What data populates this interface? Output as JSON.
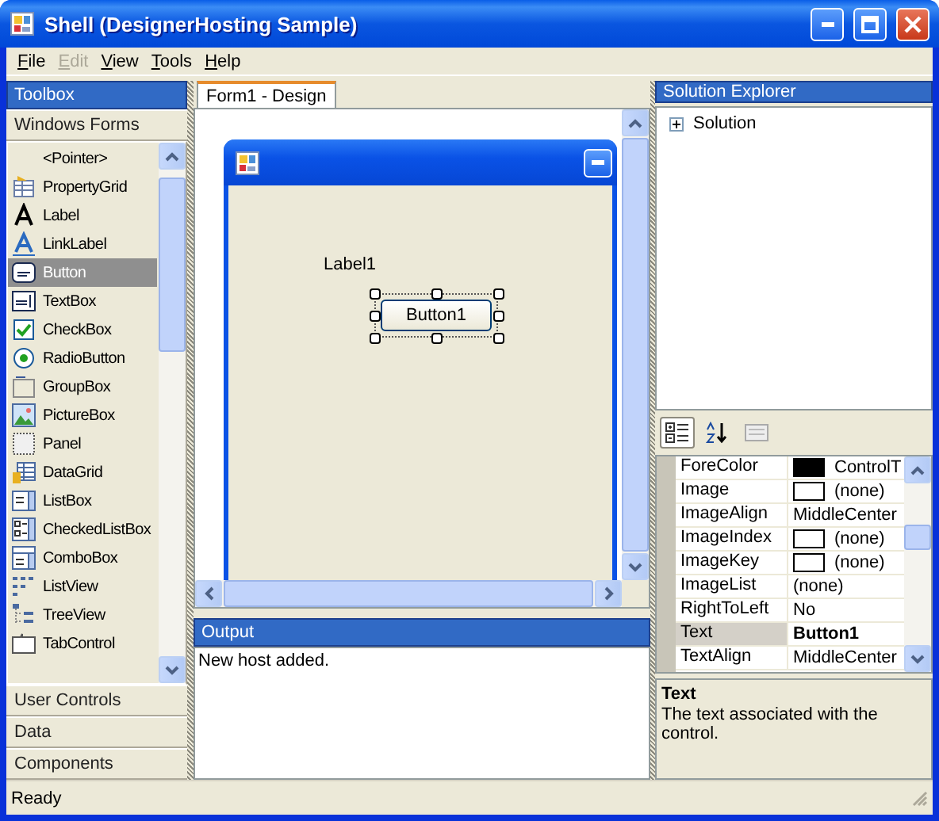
{
  "window": {
    "title": "Shell (DesignerHosting Sample)"
  },
  "menu": [
    {
      "label": "File",
      "disabled": false
    },
    {
      "label": "Edit",
      "disabled": true
    },
    {
      "label": "View",
      "disabled": false
    },
    {
      "label": "Tools",
      "disabled": false
    },
    {
      "label": "Help",
      "disabled": false
    }
  ],
  "toolbox": {
    "title": "Toolbox",
    "categories": [
      {
        "label": "Windows Forms",
        "expanded": true,
        "items": [
          {
            "label": "<Pointer>",
            "selected": false
          },
          {
            "label": "PropertyGrid",
            "selected": false
          },
          {
            "label": "Label",
            "selected": false
          },
          {
            "label": "LinkLabel",
            "selected": false
          },
          {
            "label": "Button",
            "selected": true
          },
          {
            "label": "TextBox",
            "selected": false
          },
          {
            "label": "CheckBox",
            "selected": false
          },
          {
            "label": "RadioButton",
            "selected": false
          },
          {
            "label": "GroupBox",
            "selected": false
          },
          {
            "label": "PictureBox",
            "selected": false
          },
          {
            "label": "Panel",
            "selected": false
          },
          {
            "label": "DataGrid",
            "selected": false
          },
          {
            "label": "ListBox",
            "selected": false
          },
          {
            "label": "CheckedListBox",
            "selected": false
          },
          {
            "label": "ComboBox",
            "selected": false
          },
          {
            "label": "ListView",
            "selected": false
          },
          {
            "label": "TreeView",
            "selected": false
          },
          {
            "label": "TabControl",
            "selected": false
          }
        ]
      },
      {
        "label": "User Controls",
        "expanded": false
      },
      {
        "label": "Data",
        "expanded": false
      },
      {
        "label": "Components",
        "expanded": false
      }
    ]
  },
  "document_tabs": [
    {
      "label": "Form1 - Design",
      "selected": true
    }
  ],
  "designer": {
    "label": "Label1",
    "button": "Button1"
  },
  "output": {
    "title": "Output",
    "lines": [
      "New host added."
    ]
  },
  "solution_explorer": {
    "title": "Solution Explorer",
    "tree": [
      {
        "label": "Solution",
        "expanded": false
      }
    ]
  },
  "properties": {
    "rows": [
      {
        "name": "ForeColor",
        "value": "ControlT",
        "color": "#000000",
        "selected": false,
        "modified": false
      },
      {
        "name": "Image",
        "value": "(none)",
        "color": "#ffffff",
        "selected": false,
        "modified": false
      },
      {
        "name": "ImageAlign",
        "value": "MiddleCenter",
        "selected": false,
        "modified": false
      },
      {
        "name": "ImageIndex",
        "value": "(none)",
        "color": "#ffffff",
        "selected": false,
        "modified": false
      },
      {
        "name": "ImageKey",
        "value": "(none)",
        "color": "#ffffff",
        "selected": false,
        "modified": false
      },
      {
        "name": "ImageList",
        "value": "(none)",
        "selected": false,
        "modified": false
      },
      {
        "name": "RightToLeft",
        "value": "No",
        "selected": false,
        "modified": false
      },
      {
        "name": "Text",
        "value": "Button1",
        "selected": true,
        "modified": true
      },
      {
        "name": "TextAlign",
        "value": "MiddleCenter",
        "selected": false,
        "modified": false
      }
    ],
    "description": {
      "title": "Text",
      "text": "The text associated with the control."
    }
  },
  "status_bar": {
    "text": "Ready"
  }
}
